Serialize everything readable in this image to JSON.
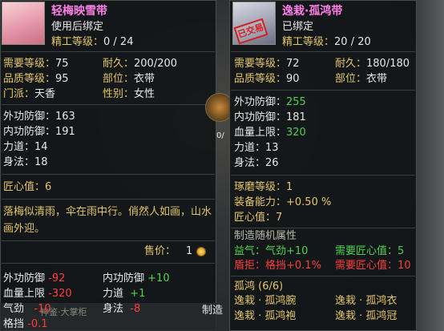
{
  "left": {
    "item_name": "轻梅映雪带",
    "bind_text": "使用后绑定",
    "refine_label": "精工等级：",
    "refine_value": "0 / 24",
    "req_level_label": "需要等级：",
    "req_level_value": "75",
    "durability_label": "耐久：",
    "durability_value": "200/200",
    "quality_label": "品质等级：",
    "quality_value": "95",
    "slot_label": "部位：",
    "slot_value": "衣带",
    "sect_label": "门派：",
    "sect_value": "天香",
    "gender_label": "性别：",
    "gender_value": "女性",
    "outer_def_label": "外功防御：",
    "outer_def_value": "163",
    "inner_def_label": "内功防御：",
    "inner_def_value": "191",
    "str_label": "力道：",
    "str_value": "14",
    "agi_label": "身法：",
    "agi_value": "18",
    "craft_label": "匠心值：",
    "craft_value": "6",
    "description": "落梅似清雨，伞在雨中行。俏然人如画，山水画外迎。",
    "price_label": "售价：",
    "price_value": "1",
    "diff_outer_label": "外功防御",
    "diff_outer_value": "-92",
    "diff_inner_label": "内功防御",
    "diff_inner_value": "+10",
    "diff_hp_label": "血量上限",
    "diff_hp_value": "-320",
    "diff_str_label": "力道",
    "diff_str_value": "+1",
    "diff_qi_label": "气劲",
    "diff_qi_value": "-10",
    "diff_agi_label": "身法",
    "diff_agi_value": "-8",
    "diff_block_label": "格挡",
    "diff_block_value": "-0.1",
    "bottom_text": "制造",
    "behind_text": "神鉴·大掌柜"
  },
  "right": {
    "item_name": "逸栽·孤鸿带",
    "bind_text": "已绑定",
    "stamp_text": "已交易",
    "refine_label": "精工等级：",
    "refine_value": "20 / 20",
    "req_level_label": "需要等级：",
    "req_level_value": "72",
    "durability_label": "耐久：",
    "durability_value": "180/180",
    "quality_label": "品质等级：",
    "quality_value": "90",
    "slot_label": "部位：",
    "slot_value": "衣带",
    "outer_def_label": "外功防御：",
    "outer_def_value": "255",
    "inner_def_label": "内功防御：",
    "inner_def_value": "181",
    "hp_label": "血量上限：",
    "hp_value": "320",
    "str_label": "力道：",
    "str_value": "13",
    "agi_label": "身法：",
    "agi_value": "26",
    "polish_label": "琢磨等级：",
    "polish_value": "1",
    "equip_label": "装备能力：",
    "equip_value": "+0.50 %",
    "craft_label": "匠心值：",
    "craft_value": "7",
    "random_title": "制造随机属性",
    "rand1_label": "益气：",
    "rand1_value": "气劲+10",
    "rand1_req_label": "需要匠心值：",
    "rand1_req_value": "5",
    "rand2_label": "盾拒：",
    "rand2_value": "格挡+0.1%",
    "rand2_req_label": "需要匠心值：",
    "rand2_req_value": "10",
    "set_title": "孤鸿 (6/6)",
    "set_items": [
      "逸栽 · 孤鸿腕",
      "逸栽 · 孤鸿衣",
      "逸栽 · 孤鸿袍",
      "逸栽 · 孤鸿冠"
    ]
  },
  "slot_caption": "0/"
}
